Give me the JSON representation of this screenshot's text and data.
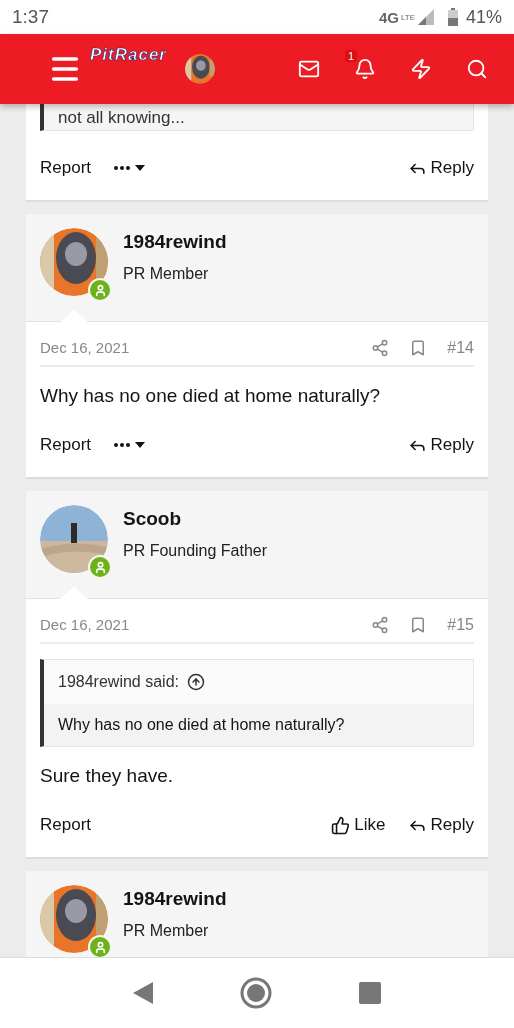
{
  "status_bar": {
    "time": "1:37",
    "network": "4G",
    "network_sub": "LTE",
    "battery": "41%"
  },
  "header": {
    "logo": "PitRacer",
    "alerts_badge": "1"
  },
  "posts": [
    {
      "quote_tail": "not all knowing...",
      "actions": [
        {
          "kind": "report",
          "label": "Report"
        },
        {
          "kind": "more"
        },
        {
          "kind": "reply",
          "label": "Reply"
        }
      ]
    },
    {
      "author": "1984rewind",
      "rank": "PR Member",
      "online": true,
      "date": "Dec 16, 2021",
      "number": "#14",
      "body": "Why has no one died at home naturally?",
      "actions": [
        {
          "kind": "report",
          "label": "Report"
        },
        {
          "kind": "more"
        },
        {
          "kind": "reply",
          "label": "Reply"
        }
      ]
    },
    {
      "author": "Scoob",
      "rank": "PR Founding Father",
      "online": true,
      "date": "Dec 16, 2021",
      "number": "#15",
      "quote": {
        "author": "1984rewind said:",
        "text": "Why has no one died at home naturally?"
      },
      "body": "Sure they have.",
      "actions": [
        {
          "kind": "report",
          "label": "Report"
        },
        {
          "kind": "like",
          "label": "Like"
        },
        {
          "kind": "reply",
          "label": "Reply"
        }
      ]
    },
    {
      "author": "1984rewind",
      "rank": "PR Member",
      "online": true
    }
  ]
}
